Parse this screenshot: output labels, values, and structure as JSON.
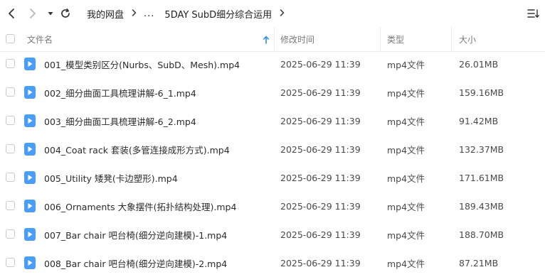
{
  "toolbar": {
    "icons": [
      "back-icon",
      "forward-icon",
      "dropdown-caret-icon",
      "refresh-icon",
      "sort-list-icon"
    ],
    "breadcrumb": [
      "我的网盘",
      "...",
      "5DAY SubD细分综合运用"
    ]
  },
  "table": {
    "columns": {
      "name": "文件名",
      "modified": "修改时间",
      "type": "类型",
      "size": "大小"
    },
    "sort": {
      "column": "name",
      "direction": "ascending",
      "icon": "sort-up-arrow-icon"
    },
    "rows": [
      {
        "name": "001_模型类别区分(Nurbs、SubD、Mesh).mp4",
        "modified": "2025-06-29 11:39",
        "type": "mp4文件",
        "size": "26.01MB"
      },
      {
        "name": "002_细分曲面工具梳理讲解-6_1.mp4",
        "modified": "2025-06-29 11:39",
        "type": "mp4文件",
        "size": "159.16MB"
      },
      {
        "name": "003_细分曲面工具梳理讲解-6_2.mp4",
        "modified": "2025-06-29 11:39",
        "type": "mp4文件",
        "size": "91.42MB"
      },
      {
        "name": "004_Coat rack 套装(多管连接成形方式).mp4",
        "modified": "2025-06-29 11:39",
        "type": "mp4文件",
        "size": "132.37MB"
      },
      {
        "name": "005_Utility 矮凳(卡边塑形).mp4",
        "modified": "2025-06-29 11:39",
        "type": "mp4文件",
        "size": "171.61MB"
      },
      {
        "name": "006_Ornaments 大象摆件(拓扑结构处理).mp4",
        "modified": "2025-06-29 11:39",
        "type": "mp4文件",
        "size": "189.43MB"
      },
      {
        "name": "007_Bar chair 吧台椅(细分逆向建模)-1.mp4",
        "modified": "2025-06-29 11:39",
        "type": "mp4文件",
        "size": "188.70MB"
      },
      {
        "name": "008_Bar chair 吧台椅(细分逆向建模)-2.mp4",
        "modified": "2025-06-29 11:39",
        "type": "mp4文件",
        "size": "87.21MB"
      }
    ]
  },
  "colors": {
    "accent": "#3b8cf0",
    "file_icon": "#4a9df8",
    "sort_arrow": "#2f8cf0",
    "divider": "#ececec"
  }
}
